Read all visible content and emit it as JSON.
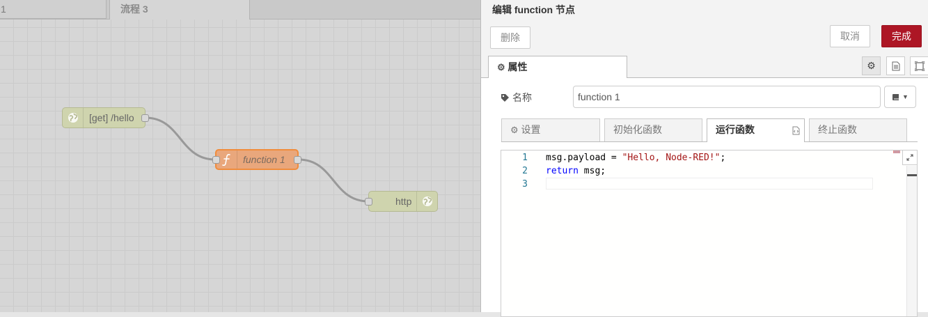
{
  "workspace": {
    "tabs": [
      {
        "label": "1"
      },
      {
        "label": "流程 3"
      }
    ],
    "nodes": {
      "http_in": {
        "label": "[get] /hello"
      },
      "function": {
        "label": "function 1"
      },
      "http_response": {
        "label": "http"
      }
    }
  },
  "tray": {
    "title": "编辑 function 节点",
    "delete_label": "删除",
    "cancel_label": "取消",
    "done_label": "完成",
    "properties_tab": "属性",
    "name_label": "名称",
    "name_value": "function 1",
    "sub_tabs": [
      {
        "label": "设置"
      },
      {
        "label": "初始化函数"
      },
      {
        "label": "运行函数"
      },
      {
        "label": "终止函数"
      }
    ],
    "code": {
      "line_numbers": [
        "1",
        "2",
        "3"
      ],
      "line1": {
        "ident": "msg.payload = ",
        "string": "\"Hello, Node-RED!\"",
        "end": ";"
      },
      "line2": {
        "keyword": "return",
        "rest": " msg;"
      }
    }
  },
  "colors": {
    "done_button": "#ad1625",
    "function_node": "#e9a77c",
    "http_node": "#cfd4ae",
    "selected_border": "#f08c3c"
  },
  "icons": [
    "globe-icon",
    "function-icon",
    "gear-icon",
    "document-icon",
    "frame-icon",
    "tag-icon",
    "book-icon",
    "caret-down-icon",
    "expand-icon",
    "code-file-icon"
  ]
}
